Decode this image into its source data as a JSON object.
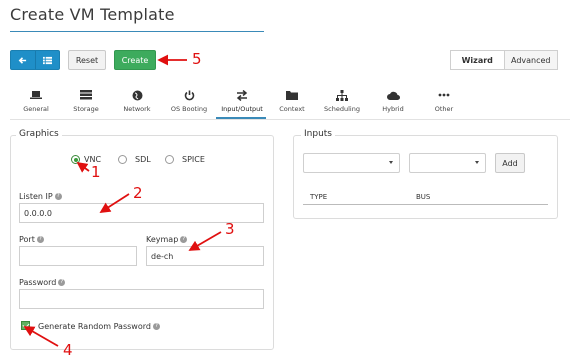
{
  "page": {
    "title": "Create VM Template"
  },
  "toolbar": {
    "reset_label": "Reset",
    "create_label": "Create",
    "modes": [
      {
        "label": "Wizard",
        "active": true
      },
      {
        "label": "Advanced",
        "active": false
      }
    ]
  },
  "tabs": [
    {
      "label": "General",
      "icon": "laptop-icon"
    },
    {
      "label": "Storage",
      "icon": "database-icon"
    },
    {
      "label": "Network",
      "icon": "globe-icon"
    },
    {
      "label": "OS Booting",
      "icon": "power-icon"
    },
    {
      "label": "Input/Output",
      "icon": "exchange-icon",
      "active": true
    },
    {
      "label": "Context",
      "icon": "folder-icon"
    },
    {
      "label": "Scheduling",
      "icon": "sitemap-icon"
    },
    {
      "label": "Hybrid",
      "icon": "cloud-icon"
    },
    {
      "label": "Other",
      "icon": "ellipsis-icon"
    }
  ],
  "graphics": {
    "legend": "Graphics",
    "options": [
      {
        "label": "VNC",
        "checked": true
      },
      {
        "label": "SDL",
        "checked": false
      },
      {
        "label": "SPICE",
        "checked": false
      }
    ],
    "listen_ip_label": "Listen IP",
    "listen_ip_value": "0.0.0.0",
    "port_label": "Port",
    "port_value": "",
    "keymap_label": "Keymap",
    "keymap_value": "de-ch",
    "password_label": "Password",
    "password_value": "",
    "random_password_label": "Generate Random Password",
    "random_password_checked": true
  },
  "inputs": {
    "legend": "Inputs",
    "add_label": "Add",
    "columns": [
      "TYPE",
      "BUS"
    ]
  },
  "annotations": [
    "1",
    "2",
    "3",
    "4",
    "5"
  ],
  "colors": {
    "primary": "#1f8fc8",
    "success": "#3dab5d",
    "accent": "#3a8ab8",
    "annotation": "#e01010"
  }
}
